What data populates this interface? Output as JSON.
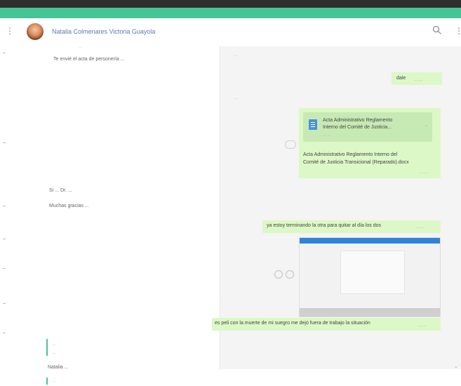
{
  "header": {
    "contact_name": "Natalia Colmenares Victoria Guayola",
    "menu_glyph": "⋮",
    "more_glyph": "⋮",
    "search_icon": "search-icon"
  },
  "left_panel": {
    "meta_1": "...",
    "msg_1": "Te envié el acta de personería ...",
    "msg_2": "Si ... Dr. ...",
    "msg_3": "Muchas gracias ...",
    "reply_1": "...",
    "reply_2": "...",
    "reply_3": "Natalia ...",
    "reply_4": "..."
  },
  "right_panel": {
    "time_1": "...",
    "bubble_1": "dale",
    "bubble_1_time": "... ...",
    "time_2": "...",
    "file_title_line1": "Acta Administrativo Reglamento",
    "file_title_line2": "Interno del Comité de Justicia...",
    "file_meta": "... ...",
    "file_caption_line1": "Acta Administrativo Reglamento Interno del",
    "file_caption_line2": "Comité de Justicia Transicional (Reparado).docx",
    "file_time": "... ...",
    "msg_long": "ya estoy terminando la otra para quitar al día los dos",
    "msg_long_time": "... ...",
    "msg_last": "es peli con la muerte de mi suegro me dejó fuera de trabajo la situación",
    "msg_last_time": "... ..."
  }
}
